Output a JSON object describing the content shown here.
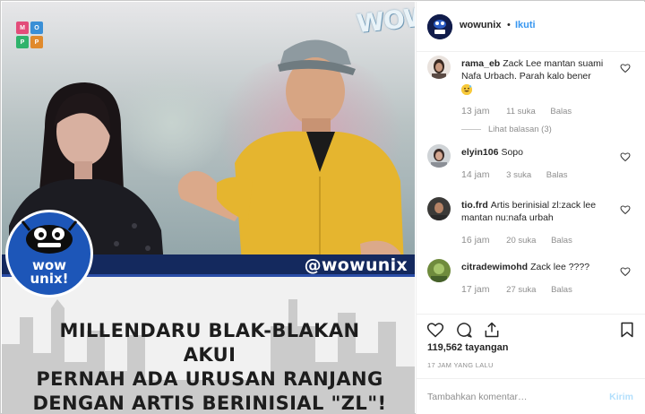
{
  "post": {
    "username": "wowunix",
    "dot": "•",
    "follow_label": "Ikuti",
    "media": {
      "app_badge_letters": [
        "M",
        "O",
        "P",
        "P"
      ],
      "corner_text": "WOW",
      "handle": "@wowunix",
      "logo_line1": "wow",
      "logo_line2": "unix!",
      "headline_line1": "MILLENDARU BLAK-BLAKAN AKUI",
      "headline_line2": "PERNAH ADA URUSAN RANJANG",
      "headline_line3": "DENGAN ARTIS BERINISIAL \"ZL\"!"
    },
    "comments": [
      {
        "user": "rama_eb",
        "text": "Zack Lee mantan suami Nafa Urbach. Parah kalo bener",
        "emoji": "grinning-sweat-emoji",
        "time": "13 jam",
        "likes": "11 suka",
        "reply": "Balas",
        "view_replies": "Lihat balasan (3)"
      },
      {
        "user": "elyin106",
        "text": "Sopo",
        "time": "14 jam",
        "likes": "3 suka",
        "reply": "Balas"
      },
      {
        "user": "tio.frd",
        "text": "Artis berinisial zl:zack lee mantan nu:nafa urbah",
        "time": "16 jam",
        "likes": "20 suka",
        "reply": "Balas"
      },
      {
        "user": "citradewimohd",
        "text": "Zack lee ????",
        "time": "17 jam",
        "likes": "27 suka",
        "reply": "Balas"
      }
    ],
    "views": "119,562 tayangan",
    "posted_ago": "17 JAM YANG LALU",
    "comment_placeholder": "Tambahkan komentar…",
    "post_label": "Kirim",
    "colors": {
      "link": "#3897f0",
      "muted": "#8e8e8e",
      "banner_navy": "#14295e"
    }
  }
}
